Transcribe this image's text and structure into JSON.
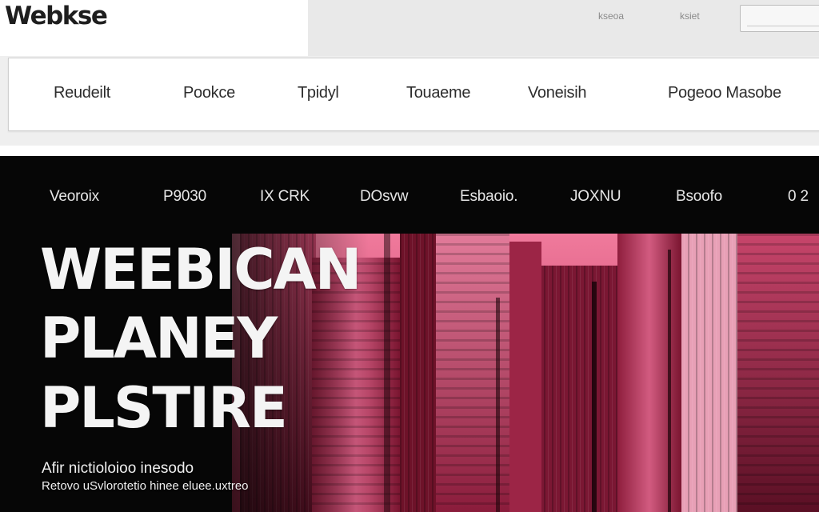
{
  "header": {
    "logo": "Webkse",
    "links": [
      "kseoa",
      "ksiet"
    ],
    "search_placeholder": ""
  },
  "menu": {
    "items": [
      "Reudeilt",
      "Pookce",
      "Tpidyl",
      "Touaeme",
      "Voneisih",
      "Pogeoo Masobe"
    ]
  },
  "nav": {
    "items": [
      "Veoroix",
      "P9030",
      "IX CRK",
      "DOsvw",
      "Esbaoio.",
      "JOXNU",
      "Bsoofo",
      "0 2"
    ]
  },
  "hero": {
    "title_lines": [
      "WEEBICAN",
      "PLANEY",
      "PLSTIRE"
    ],
    "subtitle_lines": [
      "Afir nictioloioo inesodo",
      "Retovo uSvlorotetio hinee eluee.uxtreo"
    ]
  },
  "colors": {
    "dark_bg": "#060606",
    "accent_pink": "#d94874",
    "accent_dark": "#7a1530"
  }
}
